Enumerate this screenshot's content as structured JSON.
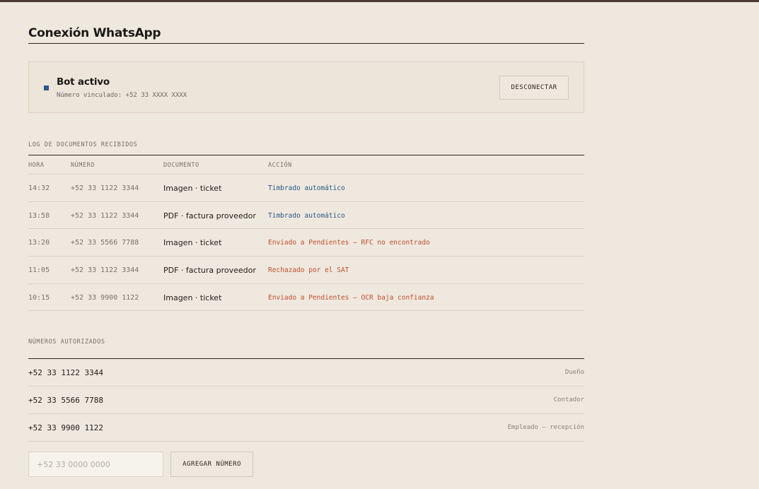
{
  "header": {
    "title": "Conexión WhatsApp"
  },
  "status": {
    "title": "Bot activo",
    "linked_number": "Número vinculado: +52 33 XXXX XXXX",
    "disconnect_label": "DESCONECTAR",
    "indicator_color": "#2a5888"
  },
  "log": {
    "section_label": "LOG DE DOCUMENTOS RECIBIDOS",
    "columns": {
      "time": "HORA",
      "number": "NÚMERO",
      "document": "DOCUMENTO",
      "action": "ACCIÓN"
    },
    "rows": [
      {
        "time": "14:32",
        "number": "+52 33 1122 3344",
        "document": "Imagen · ticket",
        "action": "Timbrado automático",
        "status": "success"
      },
      {
        "time": "13:58",
        "number": "+52 33 1122 3344",
        "document": "PDF · factura proveedor",
        "action": "Timbrado automático",
        "status": "success"
      },
      {
        "time": "13:20",
        "number": "+52 33 5566 7788",
        "document": "Imagen · ticket",
        "action": "Enviado a Pendientes — RFC no encontrado",
        "status": "warning"
      },
      {
        "time": "11:05",
        "number": "+52 33 1122 3344",
        "document": "PDF · factura proveedor",
        "action": "Rechazado por el SAT",
        "status": "warning"
      },
      {
        "time": "10:15",
        "number": "+52 33 9900 1122",
        "document": "Imagen · ticket",
        "action": "Enviado a Pendientes — OCR baja confianza",
        "status": "warning"
      }
    ],
    "colors": {
      "success": "#2a5888",
      "warning": "#c0502e"
    }
  },
  "authorized": {
    "section_label": "NÚMEROS AUTORIZADOS",
    "rows": [
      {
        "number": "+52 33 1122 3344",
        "role": "Dueño"
      },
      {
        "number": "+52 33 5566 7788",
        "role": "Contador"
      },
      {
        "number": "+52 33 9900 1122",
        "role": "Empleado — recepción"
      }
    ],
    "input_placeholder": "+52 33 0000 0000",
    "add_label": "AGREGAR NÚMERO"
  }
}
